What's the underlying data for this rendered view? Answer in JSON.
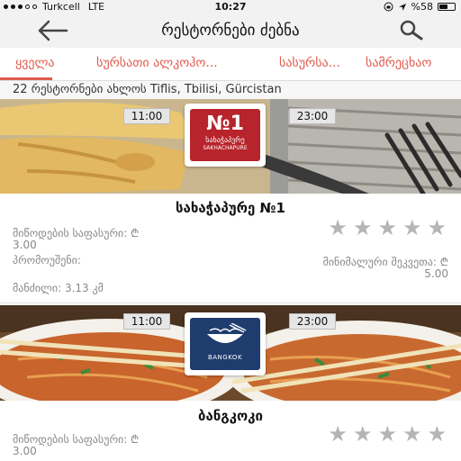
{
  "status_bar": {
    "carrier": "Turkcell",
    "network": "LTE",
    "time": "10:27",
    "battery": "%58",
    "battery_level": 0.58
  },
  "nav": {
    "title": "რესტორნები ძებნა",
    "back_icon": "arrow-left-icon",
    "search_icon": "search-icon"
  },
  "tabs": [
    {
      "label": "ყველა"
    },
    {
      "label": "სურსათი ალკოჰო..."
    },
    {
      "label": "სასურსა..."
    },
    {
      "label": "სამრეცხაო"
    }
  ],
  "location_text": "22 რესტორნები ახლოს Tiflis, Tbilisi, Gürcistan",
  "restaurants": [
    {
      "open_time": "11:00",
      "close_time": "23:00",
      "logo_text_main": "№1",
      "logo_text_sub": "სახაჭაპურე",
      "logo_text_latin": "SAKHACHAPURE",
      "name": "სახაჭაპურე №1",
      "rating": 0,
      "delivery_label": "მიწოდების საფასური: ₾",
      "delivery_value": "3.00",
      "promo_label": "პრომოუშენი:",
      "min_order_label": "მინიმალური შეკვეთა: ₾",
      "min_order_value": "5.00",
      "distance": "მანძილი: 3.13 კმ"
    },
    {
      "open_time": "11:00",
      "close_time": "23:00",
      "logo_text_main": "BANGKOK",
      "name": "ბანგკოკი",
      "rating": 0,
      "delivery_label": "მიწოდების საფასური: ₾",
      "delivery_value": "3.00"
    }
  ],
  "colors": {
    "accent": "#e05a4e",
    "logo_red": "#b8242b",
    "logo_blue": "#1f3c6e"
  }
}
